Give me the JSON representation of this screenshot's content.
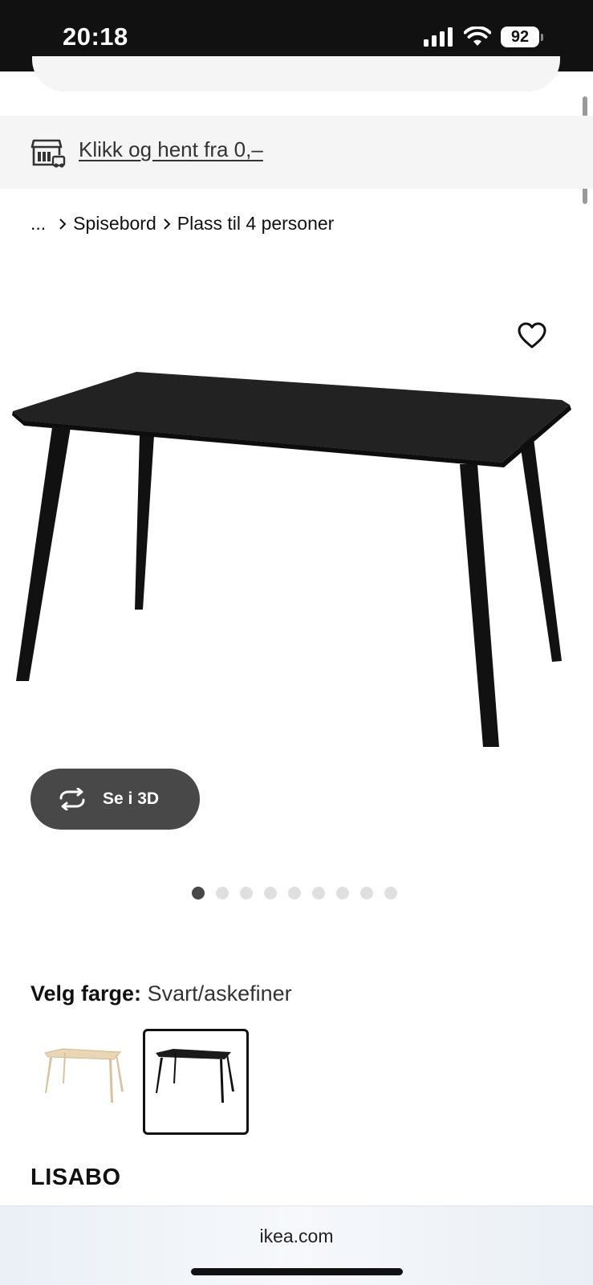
{
  "status_bar": {
    "time": "20:18",
    "battery": "92"
  },
  "banner": {
    "text": "Klikk og hent fra 0,–",
    "icon": "store-pickup-icon"
  },
  "breadcrumb": {
    "ellipsis": "...",
    "items": [
      "Spisebord",
      "Plass til 4 personer"
    ]
  },
  "gallery": {
    "favorite_icon": "heart-icon",
    "view_3d_label": "Se i 3D",
    "view_3d_icon": "rotate-icon",
    "slide_count": 9,
    "active_slide": 1
  },
  "color": {
    "label": "Velg farge:",
    "selected": "Svart/askefiner",
    "options": [
      "ash-veneer",
      "black-ash-veneer"
    ]
  },
  "product": {
    "name": "LISABO"
  },
  "browser": {
    "url": "ikea.com"
  }
}
